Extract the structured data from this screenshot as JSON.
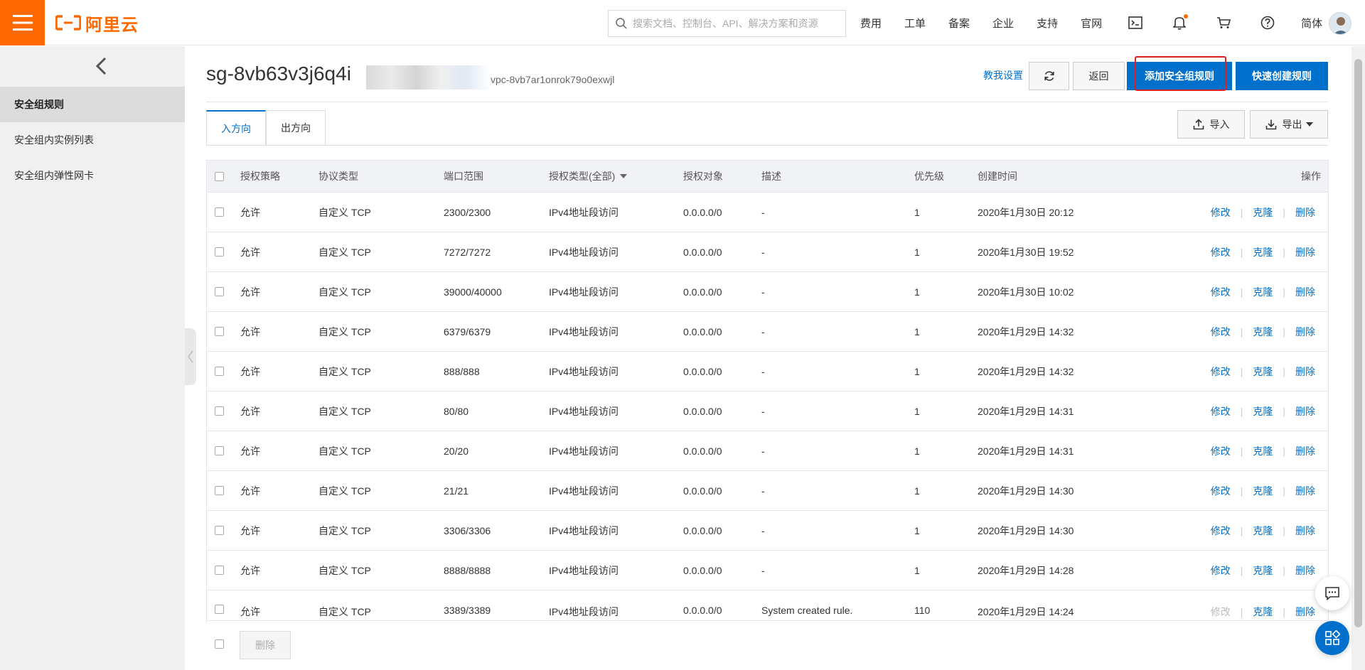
{
  "header": {
    "logo_text": "阿里云",
    "search_placeholder": "搜索文档、控制台、API、解决方案和资源",
    "nav": [
      "费用",
      "工单",
      "备案",
      "企业",
      "支持",
      "官网"
    ],
    "lang": "简体",
    "accent_color": "#ff6a00"
  },
  "sidebar": {
    "items": [
      "安全组规则",
      "安全组内实例列表",
      "安全组内弹性网卡"
    ]
  },
  "main": {
    "title": "sg-8vb63v3j6q4i",
    "vpc": "vpc-8vb7ar1onrok79o0exwjl",
    "help_link": "教我设置",
    "back_label": "返回",
    "add_rule_label": "添加安全组规则",
    "quick_rule_label": "快速创建规则",
    "import_label": "导入",
    "export_label": "导出",
    "tabs": [
      "入方向",
      "出方向"
    ],
    "primary_color": "#0070cc"
  },
  "table": {
    "headers": [
      "授权策略",
      "协议类型",
      "端口范围",
      "授权类型(全部)",
      "授权对象",
      "描述",
      "优先级",
      "创建时间",
      "操作"
    ],
    "ops": [
      "修改",
      "克隆",
      "删除"
    ],
    "rows": [
      {
        "policy": "允许",
        "protocol": "自定义 TCP",
        "port": "2300/2300",
        "auth_type": "IPv4地址段访问",
        "object": "0.0.0.0/0",
        "desc": "-",
        "priority": "1",
        "time": "2020年1月30日 20:12"
      },
      {
        "policy": "允许",
        "protocol": "自定义 TCP",
        "port": "7272/7272",
        "auth_type": "IPv4地址段访问",
        "object": "0.0.0.0/0",
        "desc": "-",
        "priority": "1",
        "time": "2020年1月30日 19:52"
      },
      {
        "policy": "允许",
        "protocol": "自定义 TCP",
        "port": "39000/40000",
        "auth_type": "IPv4地址段访问",
        "object": "0.0.0.0/0",
        "desc": "-",
        "priority": "1",
        "time": "2020年1月30日 10:02"
      },
      {
        "policy": "允许",
        "protocol": "自定义 TCP",
        "port": "6379/6379",
        "auth_type": "IPv4地址段访问",
        "object": "0.0.0.0/0",
        "desc": "-",
        "priority": "1",
        "time": "2020年1月29日 14:32"
      },
      {
        "policy": "允许",
        "protocol": "自定义 TCP",
        "port": "888/888",
        "auth_type": "IPv4地址段访问",
        "object": "0.0.0.0/0",
        "desc": "-",
        "priority": "1",
        "time": "2020年1月29日 14:32"
      },
      {
        "policy": "允许",
        "protocol": "自定义 TCP",
        "port": "80/80",
        "auth_type": "IPv4地址段访问",
        "object": "0.0.0.0/0",
        "desc": "-",
        "priority": "1",
        "time": "2020年1月29日 14:31"
      },
      {
        "policy": "允许",
        "protocol": "自定义 TCP",
        "port": "20/20",
        "auth_type": "IPv4地址段访问",
        "object": "0.0.0.0/0",
        "desc": "-",
        "priority": "1",
        "time": "2020年1月29日 14:31"
      },
      {
        "policy": "允许",
        "protocol": "自定义 TCP",
        "port": "21/21",
        "auth_type": "IPv4地址段访问",
        "object": "0.0.0.0/0",
        "desc": "-",
        "priority": "1",
        "time": "2020年1月29日 14:30"
      },
      {
        "policy": "允许",
        "protocol": "自定义 TCP",
        "port": "3306/3306",
        "auth_type": "IPv4地址段访问",
        "object": "0.0.0.0/0",
        "desc": "-",
        "priority": "1",
        "time": "2020年1月29日 14:30"
      },
      {
        "policy": "允许",
        "protocol": "自定义 TCP",
        "port": "8888/8888",
        "auth_type": "IPv4地址段访问",
        "object": "0.0.0.0/0",
        "desc": "-",
        "priority": "1",
        "time": "2020年1月29日 14:28"
      },
      {
        "policy": "允许",
        "protocol": "自定义 TCP",
        "port": "3389/3389",
        "auth_type": "IPv4地址段访问",
        "object": "0.0.0.0/0",
        "desc": "System created rule.",
        "priority": "110",
        "time": "2020年1月29日 14:24",
        "edit_disabled": true
      }
    ]
  },
  "footer": {
    "delete_label": "删除"
  }
}
